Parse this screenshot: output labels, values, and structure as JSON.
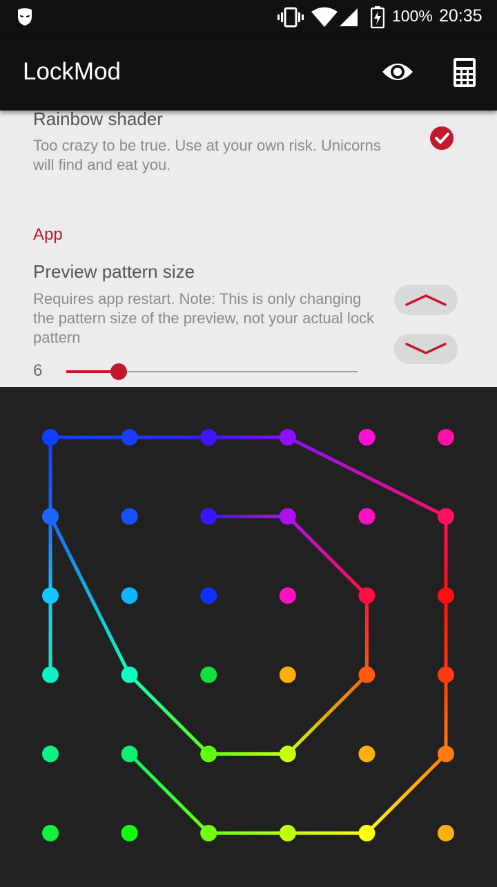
{
  "status_bar": {
    "battery_percent": "100%",
    "time": "20:35",
    "icons": [
      "mask-icon",
      "vibrate-icon",
      "wifi-icon",
      "signal-icon",
      "battery-charging-icon"
    ]
  },
  "app_bar": {
    "title": "LockMod",
    "actions": [
      "eye-icon",
      "calculator-icon"
    ]
  },
  "settings": {
    "rainbow": {
      "title": "Rainbow shader",
      "summary": "Too crazy to be true. Use at your own risk. Unicorns will find and eat you.",
      "checked": true
    },
    "category": "App",
    "preview_size": {
      "title": "Preview pattern size",
      "summary": "Requires app restart. Note: This is only changing the pattern size of the preview, not your actual lock pattern",
      "value": "6",
      "slider_fraction": 0.18
    }
  },
  "colors": {
    "accent": "#c0192d",
    "toolbar": "#111111",
    "settings_bg": "#ececec",
    "pattern_bg": "#212121"
  },
  "pattern": {
    "grid_size": 6,
    "dot_colors": [
      [
        "#1040ff",
        "#1a3cff",
        "#3d16ff",
        "#8a10ff",
        "#ff10d6",
        "#ff10a8"
      ],
      [
        "#1a66ff",
        "#1650ff",
        "#3318ff",
        "#b010f0",
        "#ff10c4",
        "#ff1060"
      ],
      [
        "#10c8ff",
        "#10b4ff",
        "#1030ff",
        "#ff10c0",
        "#ff1040",
        "#ff1010"
      ],
      [
        "#10f0c8",
        "#10ffc0",
        "#10e040",
        "#ffb010",
        "#ff5a10",
        "#ff3a10"
      ],
      [
        "#10f080",
        "#10f070",
        "#60ff10",
        "#c8ff10",
        "#ffb010",
        "#ff7a10"
      ],
      [
        "#10f040",
        "#10ff10",
        "#70ff10",
        "#c0ff10",
        "#ffff10",
        "#ffb010"
      ]
    ],
    "path": [
      [
        0,
        4
      ],
      [
        1,
        4
      ],
      [
        2,
        3
      ],
      [
        2,
        2
      ],
      [
        3,
        2
      ],
      [
        3,
        1
      ],
      [
        2,
        1
      ],
      [
        1,
        0
      ],
      [
        0,
        0
      ],
      [
        0,
        1
      ],
      [
        0,
        2
      ],
      [
        0,
        3
      ],
      [
        1,
        5
      ],
      [
        2,
        5
      ],
      [
        3,
        5
      ],
      [
        4,
        5
      ],
      [
        5,
        4
      ],
      [
        5,
        3
      ],
      [
        5,
        2
      ],
      [
        5,
        1
      ],
      [
        5,
        0
      ],
      [
        4,
        0
      ]
    ],
    "path_segments": [
      [
        [
          0,
          3
        ],
        [
          0,
          0
        ],
        [
          0,
          1
        ],
        [
          0,
          2
        ],
        [
          0,
          3
        ]
      ],
      [
        [
          2,
          1
        ],
        [
          3,
          1
        ],
        [
          4,
          2
        ],
        [
          4,
          3
        ],
        [
          3,
          4
        ],
        [
          2,
          4
        ],
        [
          1,
          3
        ],
        [
          0,
          1
        ],
        [
          0,
          0
        ],
        [
          1,
          0
        ],
        [
          2,
          0
        ],
        [
          3,
          0
        ],
        [
          5,
          1
        ],
        [
          5,
          2
        ],
        [
          5,
          3
        ],
        [
          5,
          4
        ],
        [
          4,
          5
        ],
        [
          3,
          5
        ],
        [
          2,
          5
        ],
        [
          1,
          4
        ]
      ]
    ]
  }
}
